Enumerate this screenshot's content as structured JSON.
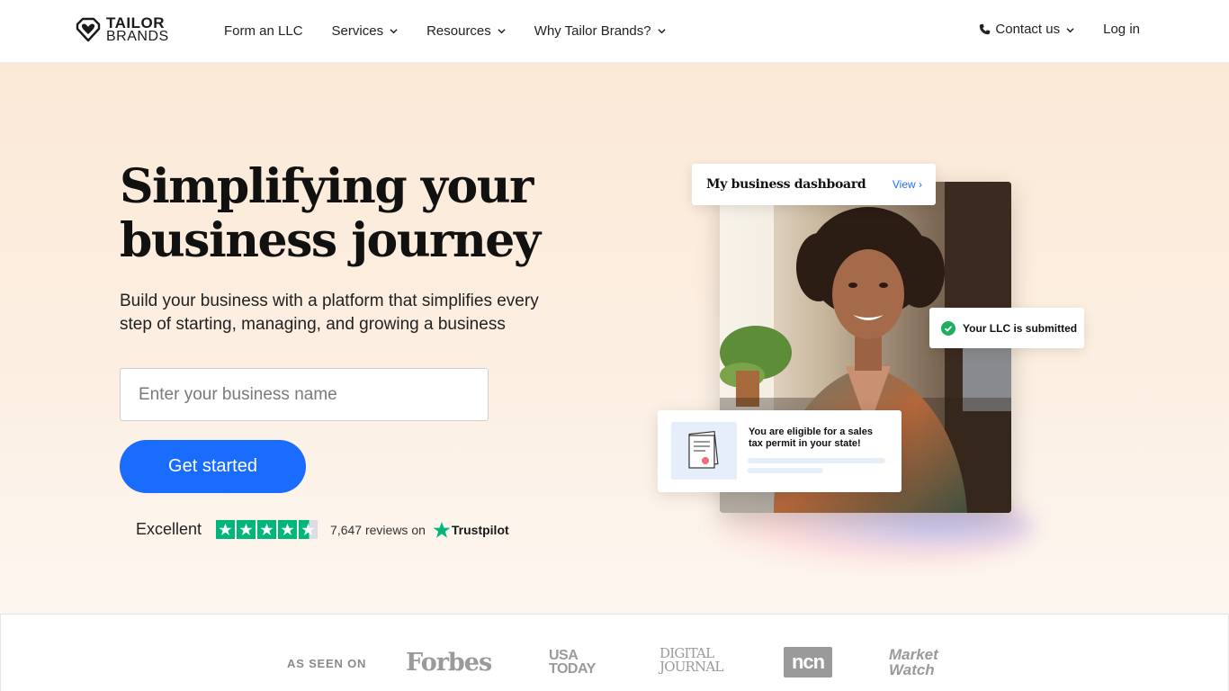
{
  "brand": {
    "line1": "TAILOR",
    "line2": "BRANDS"
  },
  "nav": {
    "links": [
      {
        "label": "Form an LLC",
        "dropdown": false
      },
      {
        "label": "Services",
        "dropdown": true
      },
      {
        "label": "Resources",
        "dropdown": true
      },
      {
        "label": "Why Tailor Brands?",
        "dropdown": true
      }
    ],
    "contact": "Contact us",
    "login": "Log in"
  },
  "hero": {
    "headline": "Simplifying your business journey",
    "subtitle": "Build your business with a platform that simplifies every step of starting, managing, and growing a business",
    "input_placeholder": "Enter your business name",
    "cta": "Get started"
  },
  "trust": {
    "rating_word": "Excellent",
    "stars": 4.5,
    "reviews_text": "7,647 reviews on",
    "provider": "Trustpilot"
  },
  "visual": {
    "dashboard_title": "My business dashboard",
    "dashboard_link": "View",
    "llc_status": "Your LLC is submitted",
    "tax_message": "You are eligible for a sales tax permit in your state!"
  },
  "press": {
    "label": "AS SEEN ON",
    "logos": [
      "Forbes",
      "USA TODAY",
      "DIGITAL JOURNAL",
      "ncn",
      "Market Watch"
    ]
  },
  "colors": {
    "accent": "#1a6cff",
    "trustpilot": "#00b67a",
    "hero_bg": "#fbe9d7"
  }
}
